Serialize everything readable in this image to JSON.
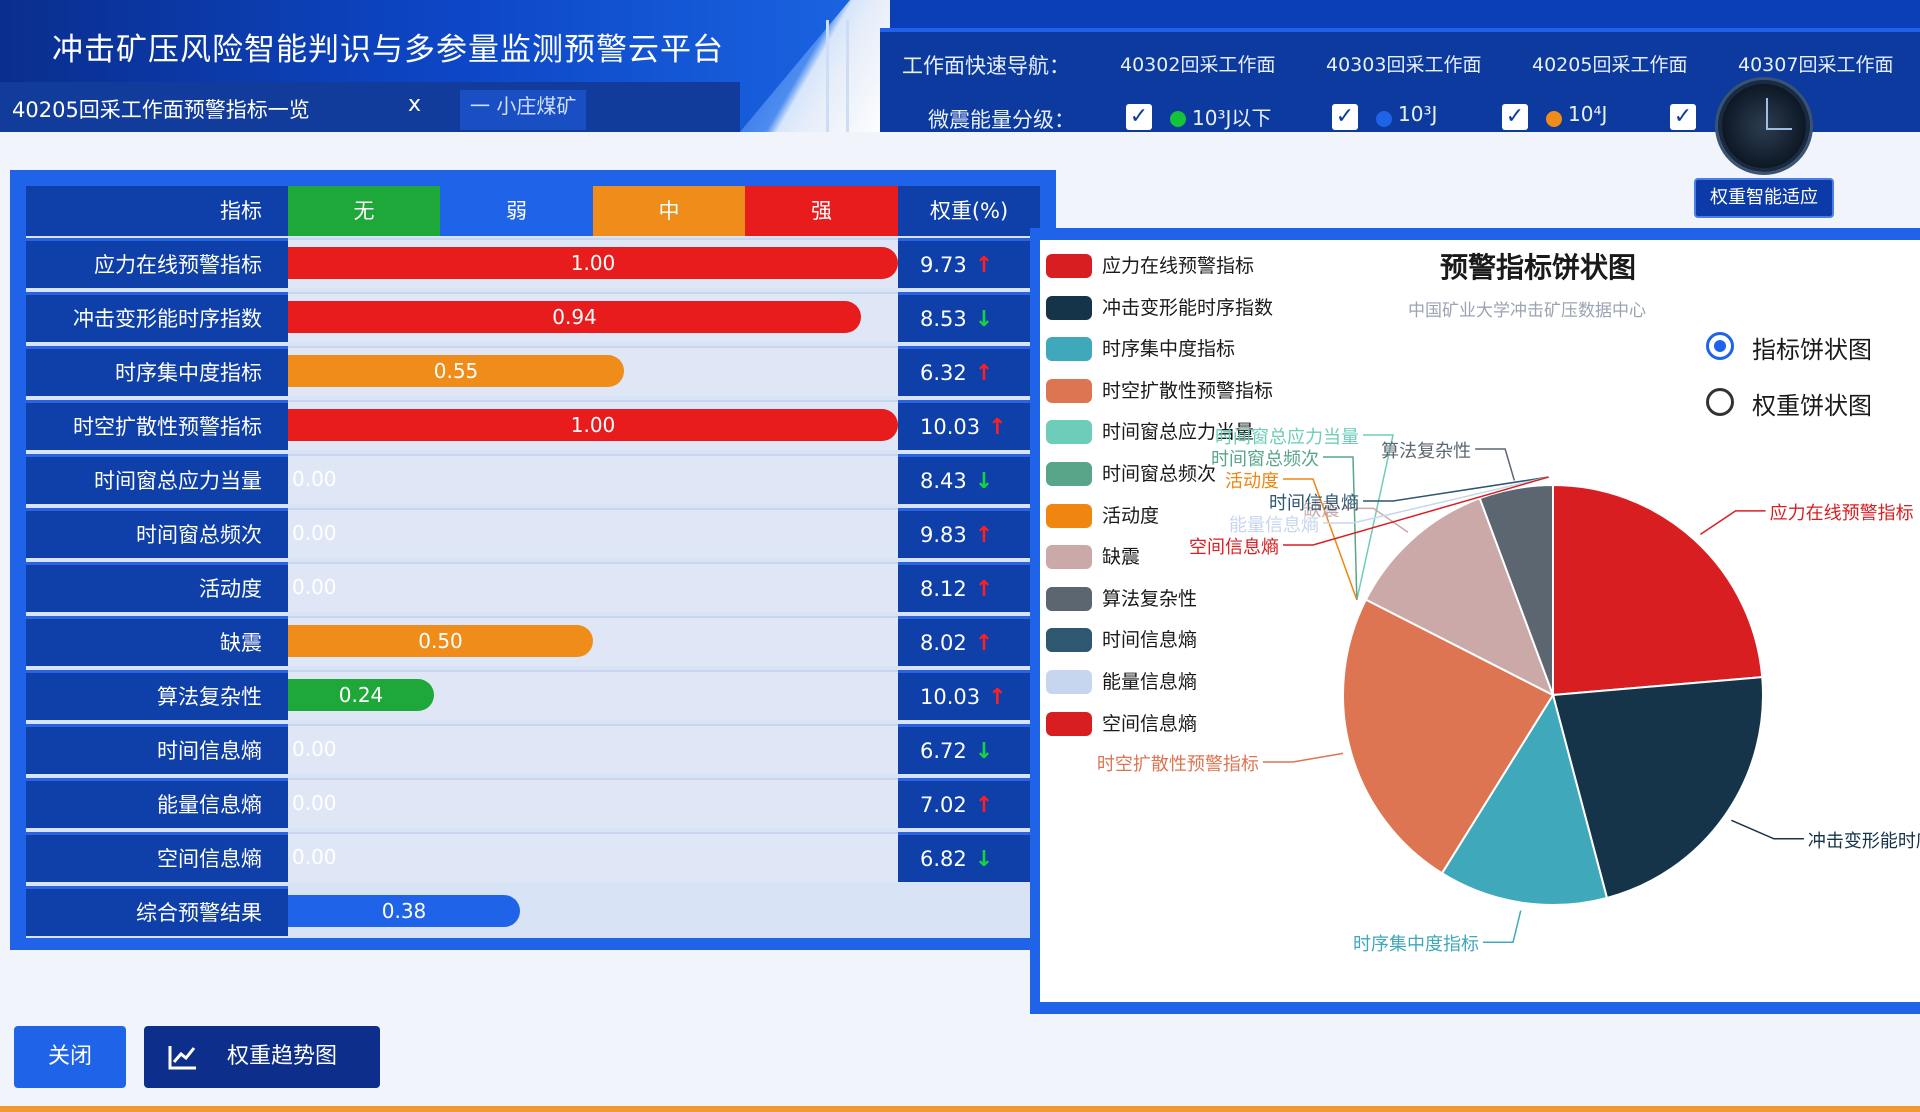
{
  "header": {
    "app_title": "冲击矿压风险智能判识与多参量监测预警云平台",
    "tab_label": "40205回采工作面预警指标一览",
    "tab_close": "x",
    "mine_name": "一 小庄煤矿"
  },
  "nav": {
    "title": "工作面快速导航：",
    "items": [
      "40302回采工作面",
      "40303回采工作面",
      "40205回采工作面",
      "40307回采工作面"
    ],
    "energy_label": "微震能量分级：",
    "energy_levels": [
      {
        "checked": "✓",
        "dot_color": "#14c23c",
        "label": "10³J以下"
      },
      {
        "checked": "✓",
        "dot_color": "#1e63e8",
        "label": "10³J"
      },
      {
        "checked": "✓",
        "dot_color": "#f08c1a",
        "label": "10⁴J"
      },
      {
        "checked": "✓",
        "dot_color": "#e81c1c",
        "label": ""
      }
    ],
    "radar_button": "权重智能适应"
  },
  "table": {
    "headers": {
      "indicator": "指标",
      "none": "无",
      "weak": "弱",
      "medium": "中",
      "strong": "强",
      "weight": "权重(%)"
    },
    "colors": {
      "none": "#1fa83a",
      "weak": "#1e63e8",
      "medium": "#f08c1a",
      "strong": "#e81c1c"
    },
    "rows": [
      {
        "name": "应力在线预警指标",
        "value": "1.00",
        "level": "strong",
        "fraction": 1.0,
        "weight": "9.73",
        "trend": "up"
      },
      {
        "name": "冲击变形能时序指数",
        "value": "0.94",
        "level": "strong",
        "fraction": 0.94,
        "weight": "8.53",
        "trend": "down"
      },
      {
        "name": "时序集中度指标",
        "value": "0.55",
        "level": "medium",
        "fraction": 0.55,
        "weight": "6.32",
        "trend": "up"
      },
      {
        "name": "时空扩散性预警指标",
        "value": "1.00",
        "level": "strong",
        "fraction": 1.0,
        "weight": "10.03",
        "trend": "up"
      },
      {
        "name": "时间窗总应力当量",
        "value": "0.00",
        "level": "none",
        "fraction": 0,
        "weight": "8.43",
        "trend": "down"
      },
      {
        "name": "时间窗总频次",
        "value": "0.00",
        "level": "none",
        "fraction": 0,
        "weight": "9.83",
        "trend": "up"
      },
      {
        "name": "活动度",
        "value": "0.00",
        "level": "none",
        "fraction": 0,
        "weight": "8.12",
        "trend": "up"
      },
      {
        "name": "缺震",
        "value": "0.50",
        "level": "medium",
        "fraction": 0.5,
        "weight": "8.02",
        "trend": "up"
      },
      {
        "name": "算法复杂性",
        "value": "0.24",
        "level": "none",
        "fraction": 0.24,
        "weight": "10.03",
        "trend": "up"
      },
      {
        "name": "时间信息熵",
        "value": "0.00",
        "level": "none",
        "fraction": 0,
        "weight": "6.72",
        "trend": "down"
      },
      {
        "name": "能量信息熵",
        "value": "0.00",
        "level": "none",
        "fraction": 0,
        "weight": "7.02",
        "trend": "up"
      },
      {
        "name": "空间信息熵",
        "value": "0.00",
        "level": "none",
        "fraction": 0,
        "weight": "6.82",
        "trend": "down"
      }
    ],
    "summary": {
      "name": "综合预警结果",
      "value": "0.38",
      "level": "weak",
      "fraction": 0.38
    }
  },
  "chart": {
    "title": "预警指标饼状图",
    "subtitle": "中国矿业大学冲击矿压数据中心",
    "radio_index": "指标饼状图",
    "radio_weight": "权重饼状图"
  },
  "chart_data": {
    "type": "pie",
    "series": [
      {
        "name": "应力在线预警指标",
        "value": 1.0,
        "color": "#d91e22"
      },
      {
        "name": "冲击变形能时序指数",
        "value": 0.94,
        "color": "#163449"
      },
      {
        "name": "时序集中度指标",
        "value": 0.55,
        "color": "#3fa8ba"
      },
      {
        "name": "时空扩散性预警指标",
        "value": 1.0,
        "color": "#de7552"
      },
      {
        "name": "时间窗总应力当量",
        "value": 0.0,
        "color": "#6ecdb8"
      },
      {
        "name": "时间窗总频次",
        "value": 0.0,
        "color": "#58a58a"
      },
      {
        "name": "活动度",
        "value": 0.0,
        "color": "#f0850f"
      },
      {
        "name": "缺震",
        "value": 0.5,
        "color": "#caa9a8"
      },
      {
        "name": "算法复杂性",
        "value": 0.24,
        "color": "#5c6670"
      },
      {
        "name": "时间信息熵",
        "value": 0.0,
        "color": "#2f5770"
      },
      {
        "name": "能量信息熵",
        "value": 0.0,
        "color": "#c7d6ef"
      },
      {
        "name": "空间信息熵",
        "value": 0.0,
        "color": "#d91e22"
      }
    ]
  },
  "footer": {
    "close_button": "关闭",
    "trend_button": "权重趋势图",
    "trend_icon": "line-chart-icon"
  }
}
